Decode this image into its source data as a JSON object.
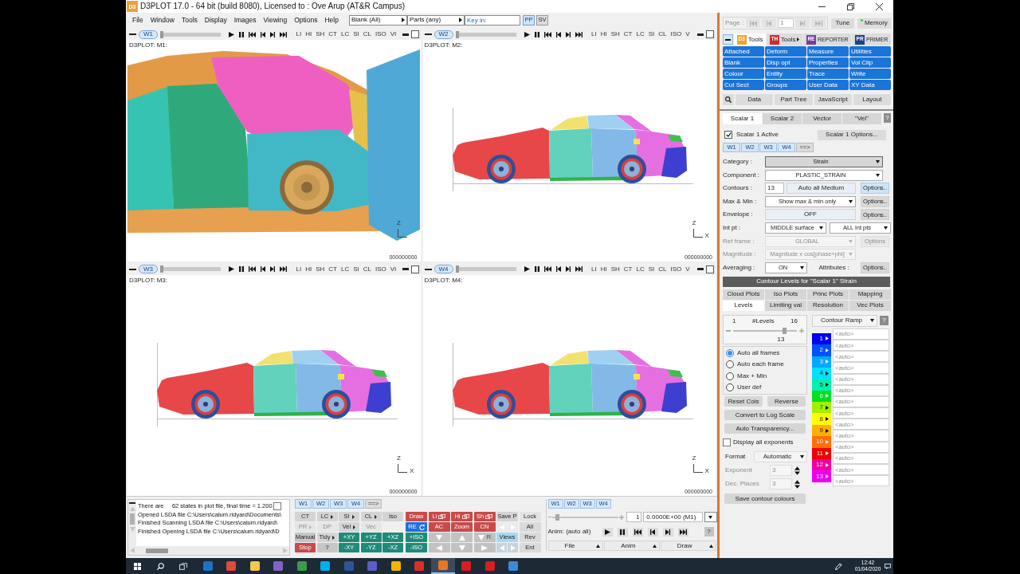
{
  "window": {
    "logo": "D3",
    "title": "D3PLOT 17.0 - 64 bit (build 8080), Licensed to : Ove Arup (AT&R Campus)"
  },
  "menu": [
    "File",
    "Window",
    "Tools",
    "Display",
    "Images",
    "Viewing",
    "Options",
    "Help"
  ],
  "toolbar": {
    "selects": [
      "Blank (All)",
      "Parts (any)"
    ],
    "key_in": {
      "placeholder": "Key in:"
    },
    "buttons": [
      {
        "label": "PP",
        "selected": true
      },
      {
        "label": "SV",
        "selected": false
      }
    ]
  },
  "viewports": [
    {
      "tab": "W1",
      "level": 0,
      "buttons": [
        "LI",
        "HI",
        "SH",
        "CT",
        "LC",
        "SI",
        "CL",
        "ISO",
        "VI"
      ],
      "checked": false,
      "label": "D3PLOT: M1:",
      "kind": "closeup",
      "axis": [
        "Z"
      ],
      "time": "000000000"
    },
    {
      "tab": "W2",
      "level": 0,
      "buttons": [
        "LI",
        "HI",
        "SH",
        "CT",
        "LC",
        "SI",
        "CL",
        "ISO",
        "V"
      ],
      "checked": false,
      "label": "D3PLOT: M2:",
      "kind": "side",
      "axis": [
        "Z",
        "X"
      ],
      "time": "000000000"
    },
    {
      "tab": "W3",
      "level": 0,
      "buttons": [
        "LI",
        "HI",
        "SH",
        "CT",
        "LC",
        "SI",
        "CL",
        "ISO",
        "VI"
      ],
      "checked": false,
      "label": "D3PLOT: M3:",
      "kind": "side",
      "axis": [
        "Z",
        "X"
      ],
      "time": "000000000"
    },
    {
      "tab": "W4",
      "level": 0,
      "buttons": [
        "LI",
        "HI",
        "SH",
        "CT",
        "LC",
        "SI",
        "CL",
        "ISO",
        "V"
      ],
      "checked": false,
      "label": "D3PLOT: M4:",
      "kind": "side",
      "axis": [
        "Z",
        "X"
      ],
      "time": "000000000"
    }
  ],
  "messages": {
    "lines": [
      "There are     62 states in plot file, final time = 1.200",
      "Opened LSDA file C:\\Users\\calum.ridyard\\Documents\\",
      "Finished Scanning LSDA file C:\\Users\\calum.ridyard\\",
      "Finished Opening LSDA file C:\\Users\\calum.ridyard\\D"
    ],
    "checked": false
  },
  "window_tabs": [
    {
      "label": "W1",
      "selected": true
    },
    {
      "label": "W2",
      "selected": true
    },
    {
      "label": "W3",
      "selected": true
    },
    {
      "label": "W4",
      "selected": true
    },
    {
      "label": "==>",
      "selected": false
    }
  ],
  "display_buttons": [
    [
      {
        "kind": "button",
        "label": "CT",
        "color": "#d4d4d4",
        "disabled": false
      },
      {
        "kind": "menu",
        "label": "LC",
        "color": "#d4d4d4",
        "disabled": false
      },
      {
        "kind": "menu",
        "label": "SI",
        "color": "#d4d4d4",
        "disabled": false
      },
      {
        "kind": "menu",
        "label": "CL",
        "color": "#d4d4d4",
        "disabled": false
      },
      {
        "kind": "button",
        "label": "Iso",
        "color": "#d4d4d4",
        "disabled": false
      }
    ],
    [
      {
        "kind": "menu",
        "label": "PR",
        "color": "#e6e6e6",
        "disabled": true
      },
      {
        "kind": "button",
        "label": "DP",
        "color": "#e6e6e6",
        "disabled": true
      },
      {
        "kind": "menu",
        "label": "Vel",
        "color": "#d4d4d4",
        "disabled": false
      },
      {
        "kind": "button",
        "label": "Vec",
        "color": "#e6e6e6",
        "disabled": true
      }
    ],
    [
      {
        "kind": "button",
        "label": "Manual",
        "color": "#c6c6c6",
        "disabled": false
      },
      {
        "kind": "menu",
        "label": "Tidy",
        "color": "#d4d4d4",
        "disabled": false
      },
      {
        "kind": "button",
        "label": "+XY",
        "color": "#1e8b79",
        "disabled": false
      },
      {
        "kind": "button",
        "label": "+YZ",
        "color": "#1e8b79",
        "disabled": false
      },
      {
        "kind": "button",
        "label": "+XZ",
        "color": "#1e8b79",
        "disabled": false
      }
    ],
    [
      {
        "kind": "button",
        "label": "Stop",
        "color": "#c94a4a",
        "disabled": false
      },
      {
        "kind": "button",
        "label": "?",
        "color": "#c6c6c6",
        "disabled": false
      },
      {
        "kind": "button",
        "label": "-XY",
        "color": "#1e8b79",
        "disabled": false
      },
      {
        "kind": "button",
        "label": "-YZ",
        "color": "#1e8b79",
        "disabled": false
      },
      {
        "kind": "button",
        "label": "-XZ",
        "color": "#1e8b79",
        "disabled": false
      }
    ]
  ],
  "view_buttons": [
    [
      {
        "kind": "button",
        "label": "Draw",
        "color": "#c94a4a",
        "disabled": false
      },
      {
        "kind": "window",
        "label": "Li",
        "color": "#c94a4a",
        "disabled": false
      },
      {
        "kind": "window",
        "label": "Hi",
        "color": "#c94a4a",
        "disabled": false
      },
      {
        "kind": "window",
        "label": "Sh",
        "color": "#c94a4a",
        "disabled": false
      },
      {
        "kind": "button",
        "label": "Save P",
        "color": "#d4d4d4",
        "disabled": false
      },
      {
        "kind": "button",
        "label": "Lock",
        "color": "#e4e4e4",
        "disabled": false
      }
    ],
    [
      {
        "kind": "refresh",
        "label": "RE",
        "color": "#1f6fe0",
        "disabled": false
      },
      {
        "kind": "button",
        "label": "AC",
        "color": "#c94a4a",
        "disabled": false
      },
      {
        "kind": "button",
        "label": "Zoom",
        "color": "#c94a4a",
        "disabled": false
      },
      {
        "kind": "button",
        "label": "CN",
        "color": "#c94a4a",
        "disabled": false
      },
      {
        "kind": "arrows",
        "disabled": true
      },
      {
        "kind": "button",
        "label": "All",
        "color": "#dadada",
        "disabled": false
      }
    ],
    [
      {
        "kind": "button",
        "label": "+ISO",
        "color": "#1e8b79",
        "disabled": false
      },
      {
        "kind": "nav",
        "disabled": false
      },
      {
        "kind": "nav",
        "disabled": false
      },
      {
        "kind": "nav",
        "label": "R",
        "disabled": false
      },
      {
        "kind": "button",
        "label": "Views",
        "color": "#a9d8f5",
        "disabled": false
      },
      {
        "kind": "button",
        "label": "Rev",
        "color": "#dadada",
        "disabled": false
      }
    ],
    [
      {
        "kind": "button",
        "label": "-ISO",
        "color": "#1e8b79",
        "disabled": false
      },
      {
        "kind": "nav",
        "disabled": false
      },
      {
        "kind": "nav",
        "disabled": false
      },
      {
        "kind": "nav",
        "disabled": false
      },
      {
        "kind": "arrows",
        "disabled": false
      },
      {
        "kind": "button",
        "label": "Ent",
        "color": "#dadada",
        "disabled": false
      }
    ]
  ],
  "animation": {
    "tabs": [
      {
        "label": "W1",
        "selected": true
      },
      {
        "label": "W2",
        "selected": true
      },
      {
        "label": "W3",
        "selected": true
      },
      {
        "label": "W4",
        "selected": true
      }
    ],
    "level": 0.05,
    "frame": "1",
    "time": "0.0000E+00 (M1)",
    "label": "Anim: (auto all)",
    "help": "?",
    "menus": [
      "File",
      "Anim",
      "Draw"
    ]
  },
  "side_panel": {
    "page": {
      "label": "Page :",
      "value": "1",
      "disabled": true
    },
    "buttons": [
      "Tune",
      "Memory"
    ],
    "tool_tabs": [
      {
        "logo": "D3",
        "color": "#f2a22c",
        "label": "Tools",
        "selected": true,
        "menu": false
      },
      {
        "logo": "TH",
        "color": "#d42a2a",
        "label": "Tools",
        "selected": false,
        "menu": true
      },
      {
        "logo": "RE",
        "color": "#7b3aa8",
        "label": "REPORTER",
        "selected": false,
        "menu": false
      },
      {
        "logo": "PR",
        "color": "#1d3f8f",
        "label": "PRIMER",
        "selected": false,
        "menu": false
      }
    ],
    "tools": [
      "Attached",
      "Deform",
      "Measure",
      "Utilities",
      "Blank",
      "Disp opt",
      "Properties",
      "Vol Clip",
      "Colour",
      "Entity",
      "Trace",
      "Write",
      "Cut Sect",
      "Groups",
      "User Data",
      "XY Data"
    ],
    "links": [
      "Data",
      "Part Tree",
      "JavaScript",
      "Layout"
    ],
    "scalar_tabs": [
      {
        "label": "Scalar 1",
        "selected": true
      },
      {
        "label": "Scalar 2",
        "selected": false
      },
      {
        "label": "Vector",
        "selected": false
      },
      {
        "label": "\"Vel\"",
        "selected": false
      }
    ],
    "help": "?",
    "active": {
      "label": "Scalar 1 Active",
      "checked": true
    },
    "options": "Scalar 1 Options...",
    "window_tabs": [
      {
        "label": "W1",
        "selected": true
      },
      {
        "label": "W2",
        "selected": true
      },
      {
        "label": "W3",
        "selected": true
      },
      {
        "label": "W4",
        "selected": true
      },
      {
        "label": "==>",
        "selected": false
      }
    ],
    "fields": [
      {
        "kind": "dropdown",
        "label": "Category :",
        "value": "Strain",
        "disabled": false
      },
      {
        "kind": "wide",
        "label": "Component :",
        "value": "PLASTIC_STRAIN",
        "disabled": false
      },
      {
        "kind": "contours",
        "label": "Contours :",
        "value": "13",
        "button": "Auto all Medium",
        "options": {
          "label": "Options..",
          "active": true,
          "disabled": false
        },
        "disabled": false
      },
      {
        "kind": "select",
        "label": "Max & Min :",
        "value": "Show max & min only",
        "options": {
          "label": "Options..",
          "active": false,
          "disabled": false
        },
        "disabled": false
      },
      {
        "kind": "toggle",
        "label": "Envelope :",
        "value": "OFF",
        "options": {
          "label": "Options..",
          "active": false,
          "disabled": false
        },
        "disabled": false
      },
      {
        "kind": "pair",
        "label": "Int pt :",
        "value": "MIDDLE surface",
        "value_2": "ALL int pts",
        "disabled": false
      },
      {
        "kind": "select",
        "label": "Ref frame :",
        "value": "GLOBAL",
        "options": {
          "label": "Options",
          "active": false,
          "disabled": true
        },
        "disabled": true
      },
      {
        "kind": "select",
        "label": "Magnitude :",
        "value": "Magnitude x cos[phase+phi]",
        "disabled": true
      },
      {
        "kind": "averaging",
        "label": "Averaging :",
        "value": "ON",
        "attributes": "Attributes :",
        "options": {
          "label": "Options..",
          "active": false,
          "disabled": false
        },
        "disabled": false
      }
    ],
    "contour_header": "Contour Levels for \"Scalar 1\" Strain",
    "contour_tabs": [
      [
        {
          "label": "Cloud Plots",
          "selected": false
        },
        {
          "label": "Iso Plots",
          "selected": false
        },
        {
          "label": "Princ Plots",
          "selected": false
        },
        {
          "label": "Mapping",
          "selected": false
        }
      ],
      [
        {
          "label": "Levels",
          "selected": true
        },
        {
          "label": "Limiting val",
          "selected": false
        },
        {
          "label": "Resolution",
          "selected": false
        },
        {
          "label": "Vec Plots",
          "selected": false
        }
      ]
    ],
    "levels": {
      "min": "1",
      "label": "#Levels",
      "max": "16",
      "level": 0.8,
      "value": "13"
    },
    "modes": [
      {
        "label": "Auto all frames",
        "selected": true
      },
      {
        "label": "Auto each frame",
        "selected": false
      },
      {
        "label": "Max + Min",
        "selected": false
      },
      {
        "label": "User def",
        "selected": false
      }
    ],
    "actions": [
      "Reset Cols",
      "Reverse"
    ],
    "wide_actions": [
      "Convert to Log Scale",
      "Auto Transparency..."
    ],
    "exponents": {
      "label": "Display all exponents",
      "checked": false
    },
    "format": {
      "label": "Format",
      "value": "Automatic"
    },
    "spinners": [
      {
        "label": "Exponent",
        "value": "3",
        "disabled": true
      },
      {
        "label": "Dec. Places",
        "value": "3",
        "disabled": true
      }
    ],
    "save": "Save contour colours",
    "ramp": {
      "label": "Contour Ramp",
      "help": "?",
      "colors": [
        {
          "label": "1",
          "color": "#0000f0"
        },
        {
          "label": "2",
          "color": "#0050ff"
        },
        {
          "label": "3",
          "color": "#00a8ff"
        },
        {
          "label": "4",
          "color": "#00e0ff"
        },
        {
          "label": "5",
          "color": "#00f0b0"
        },
        {
          "label": "6",
          "color": "#00e020"
        },
        {
          "label": "7",
          "color": "#a0f000"
        },
        {
          "label": "8",
          "color": "#ffff00"
        },
        {
          "label": "9",
          "color": "#ffb000"
        },
        {
          "label": "10",
          "color": "#ff7000"
        },
        {
          "label": "11",
          "color": "#f00000"
        },
        {
          "label": "12",
          "color": "#f000a0"
        },
        {
          "label": "13",
          "color": "#f000f0"
        }
      ],
      "fields": [
        {
          "placeholder": "<auto>"
        },
        {
          "placeholder": "<auto>"
        },
        {
          "placeholder": "<auto>"
        },
        {
          "placeholder": "<auto>"
        },
        {
          "placeholder": "<auto>"
        },
        {
          "placeholder": "<auto>"
        },
        {
          "placeholder": "<auto>"
        },
        {
          "placeholder": "<auto>"
        },
        {
          "placeholder": "<auto>"
        },
        {
          "placeholder": "<auto>"
        },
        {
          "placeholder": "<auto>"
        },
        {
          "placeholder": "<auto>"
        },
        {
          "placeholder": "<auto>"
        },
        {
          "placeholder": "<auto>"
        }
      ]
    }
  },
  "taskbar": {
    "apps": [
      {
        "color": "#1a73c8",
        "selected": false
      },
      {
        "color": "#dd4b39",
        "selected": false
      },
      {
        "color": "#f2c94c",
        "selected": false
      },
      {
        "color": "#8661c5",
        "selected": false
      },
      {
        "color": "#3c9a48",
        "selected": false
      },
      {
        "color": "#00aff0",
        "selected": false
      },
      {
        "color": "#2b579a",
        "selected": false
      },
      {
        "color": "#5b5fc7",
        "selected": false
      },
      {
        "color": "#f4b400",
        "selected": false
      },
      {
        "color": "#d93025",
        "selected": false
      },
      {
        "color": "#e87722",
        "selected": true
      },
      {
        "color": "#d42020",
        "selected": false
      },
      {
        "color": "#d42020",
        "selected": false
      },
      {
        "color": "#3a8ad8",
        "selected": false
      }
    ],
    "time": "12:42",
    "date": "01/04/2020"
  }
}
